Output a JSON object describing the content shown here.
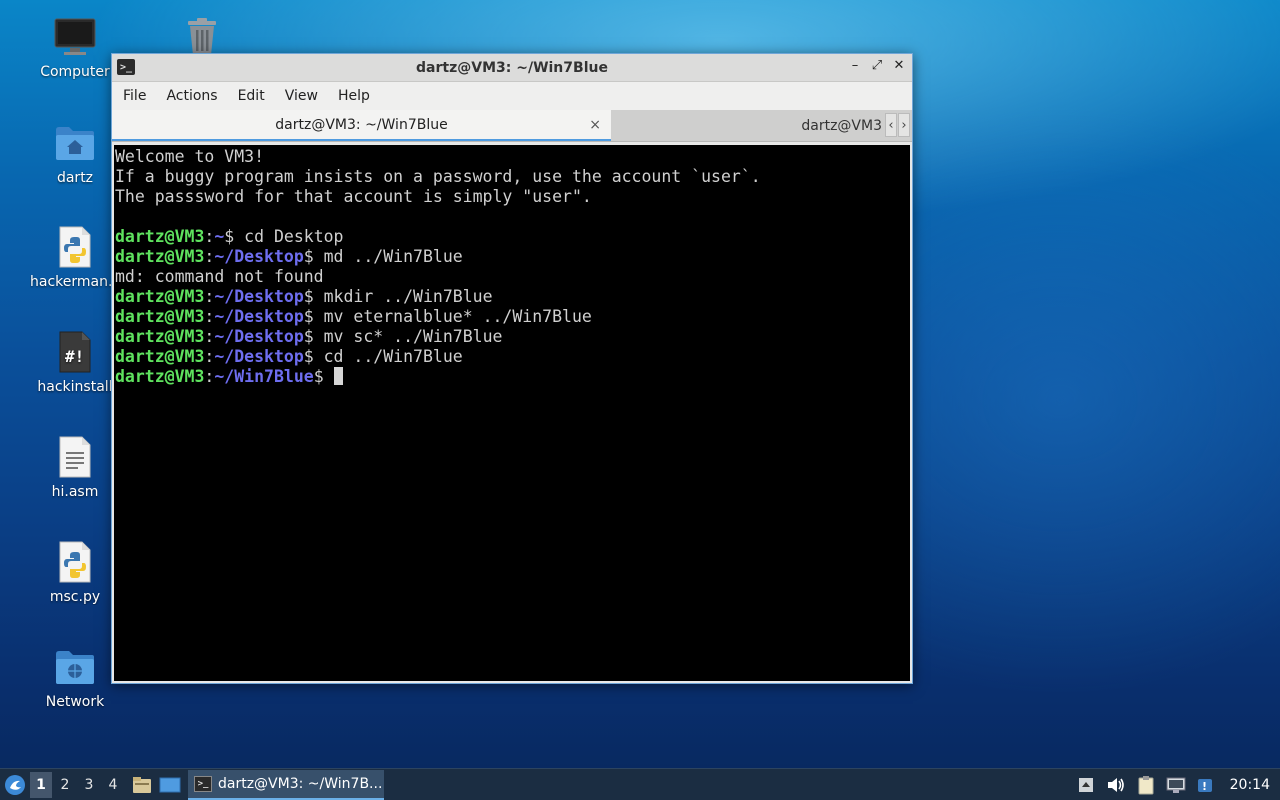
{
  "desktop": {
    "icons": [
      {
        "label": "Computer",
        "icon": "computer-icon"
      },
      {
        "label": "",
        "icon": "trash-icon"
      },
      {
        "label": "dartz",
        "icon": "home-folder-icon"
      },
      {
        "label": "hackerman.py",
        "icon": "python-file-icon"
      },
      {
        "label": "hackinstall",
        "icon": "script-file-icon"
      },
      {
        "label": "hi.asm",
        "icon": "text-file-icon"
      },
      {
        "label": "msc.py",
        "icon": "python-file-icon"
      },
      {
        "label": "Network",
        "icon": "network-folder-icon"
      }
    ]
  },
  "window": {
    "title": "dartz@VM3: ~/Win7Blue",
    "controls": {
      "minimize": "–",
      "maximize": "⤢",
      "close": "✕"
    },
    "menu": [
      "File",
      "Actions",
      "Edit",
      "View",
      "Help"
    ],
    "tabs": [
      {
        "label": "dartz@VM3: ~/Win7Blue",
        "active": true
      },
      {
        "label": "dartz@VM3",
        "active": false
      }
    ],
    "tab_close": "×",
    "tab_scroll": {
      "left": "‹",
      "right": "›"
    }
  },
  "terminal": {
    "intro": [
      "Welcome to VM3!",
      "If a buggy program insists on a password, use the account `user`.",
      "The passsword for that account is simply \"user\".",
      ""
    ],
    "prompt_user": "dartz@VM3",
    "prompt_sep": ":",
    "prompt_dollar": "$ ",
    "lines": [
      {
        "path": "~",
        "cmd": "cd Desktop"
      },
      {
        "path": "~/Desktop",
        "cmd": "md ../Win7Blue"
      },
      {
        "output": "md: command not found"
      },
      {
        "path": "~/Desktop",
        "cmd": "mkdir ../Win7Blue"
      },
      {
        "path": "~/Desktop",
        "cmd": "mv eternalblue* ../Win7Blue"
      },
      {
        "path": "~/Desktop",
        "cmd": "mv sc* ../Win7Blue"
      },
      {
        "path": "~/Desktop",
        "cmd": "cd ../Win7Blue"
      },
      {
        "path": "~/Win7Blue",
        "cmd": ""
      }
    ]
  },
  "taskbar": {
    "workspaces": [
      "1",
      "2",
      "3",
      "4"
    ],
    "active_workspace": "1",
    "task_label": "dartz@VM3: ~/Win7B...",
    "clock": "20:14"
  }
}
